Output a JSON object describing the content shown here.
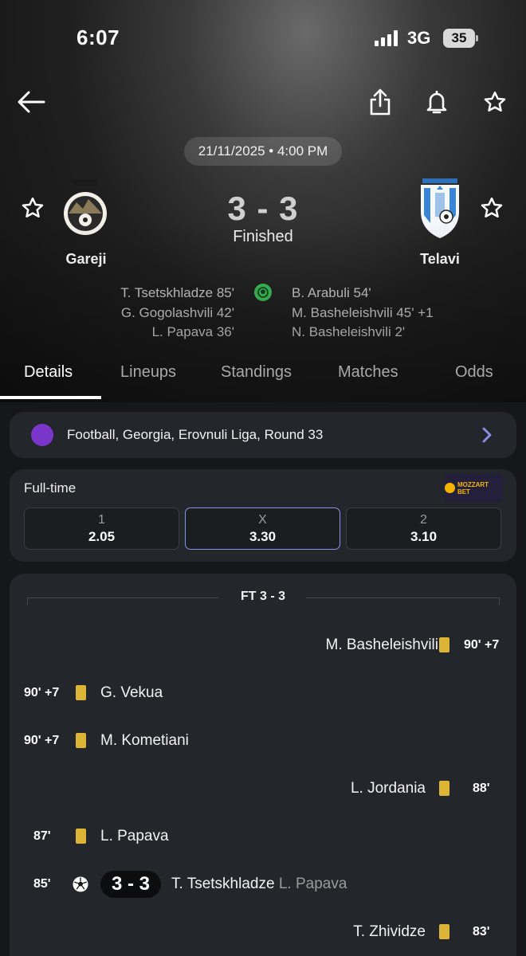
{
  "status_bar": {
    "time": "6:07",
    "network": "3G",
    "battery": "35"
  },
  "match": {
    "date": "21/11/2025 • 4:00 PM",
    "home": {
      "name": "Gareji"
    },
    "away": {
      "name": "Telavi"
    },
    "score": "3 - 3",
    "status": "Finished",
    "home_scorers": [
      "T. Tsetskhladze 85'",
      "G. Gogolashvili 42'",
      "L. Papava 36'"
    ],
    "away_scorers": [
      "B. Arabuli 54'",
      "M. Basheleishvili 45' +1",
      "N. Basheleishvili 2'"
    ]
  },
  "tabs": [
    {
      "label": "Details",
      "active": true
    },
    {
      "label": "Lineups",
      "active": false
    },
    {
      "label": "Standings",
      "active": false
    },
    {
      "label": "Matches",
      "active": false
    },
    {
      "label": "Odds",
      "active": false
    }
  ],
  "league": {
    "text": "Football, Georgia, Erovnuli Liga, Round 33"
  },
  "odds": {
    "title": "Full-time",
    "bookmaker": "MOZZART BET",
    "options": [
      {
        "label": "1",
        "value": "2.05",
        "selected": false
      },
      {
        "label": "X",
        "value": "3.30",
        "selected": true
      },
      {
        "label": "2",
        "value": "3.10",
        "selected": false
      }
    ]
  },
  "events": {
    "header": "FT 3 - 3",
    "items": [
      {
        "side": "away",
        "type": "yellow-card",
        "time": "90' +7",
        "player": "M. Basheleishvili"
      },
      {
        "side": "home",
        "type": "yellow-card",
        "time": "90' +7",
        "player": "G. Vekua"
      },
      {
        "side": "home",
        "type": "yellow-card",
        "time": "90' +7",
        "player": "M. Kometiani"
      },
      {
        "side": "away",
        "type": "yellow-card",
        "time": "88'",
        "player": "L. Jordania"
      },
      {
        "side": "home",
        "type": "yellow-card",
        "time": "87'",
        "player": "L. Papava"
      },
      {
        "side": "home",
        "type": "goal",
        "time": "85'",
        "score": "3 - 3",
        "player": "T. Tsetskhladze",
        "assist": "L. Papava"
      },
      {
        "side": "away",
        "type": "yellow-card",
        "time": "83'",
        "player": "T. Zhividze"
      }
    ]
  },
  "colors": {
    "yellow_card": "#dcb436",
    "goal": "#3cc45a",
    "accent": "#8a8fe8",
    "league_logo": "#7a35c9"
  }
}
